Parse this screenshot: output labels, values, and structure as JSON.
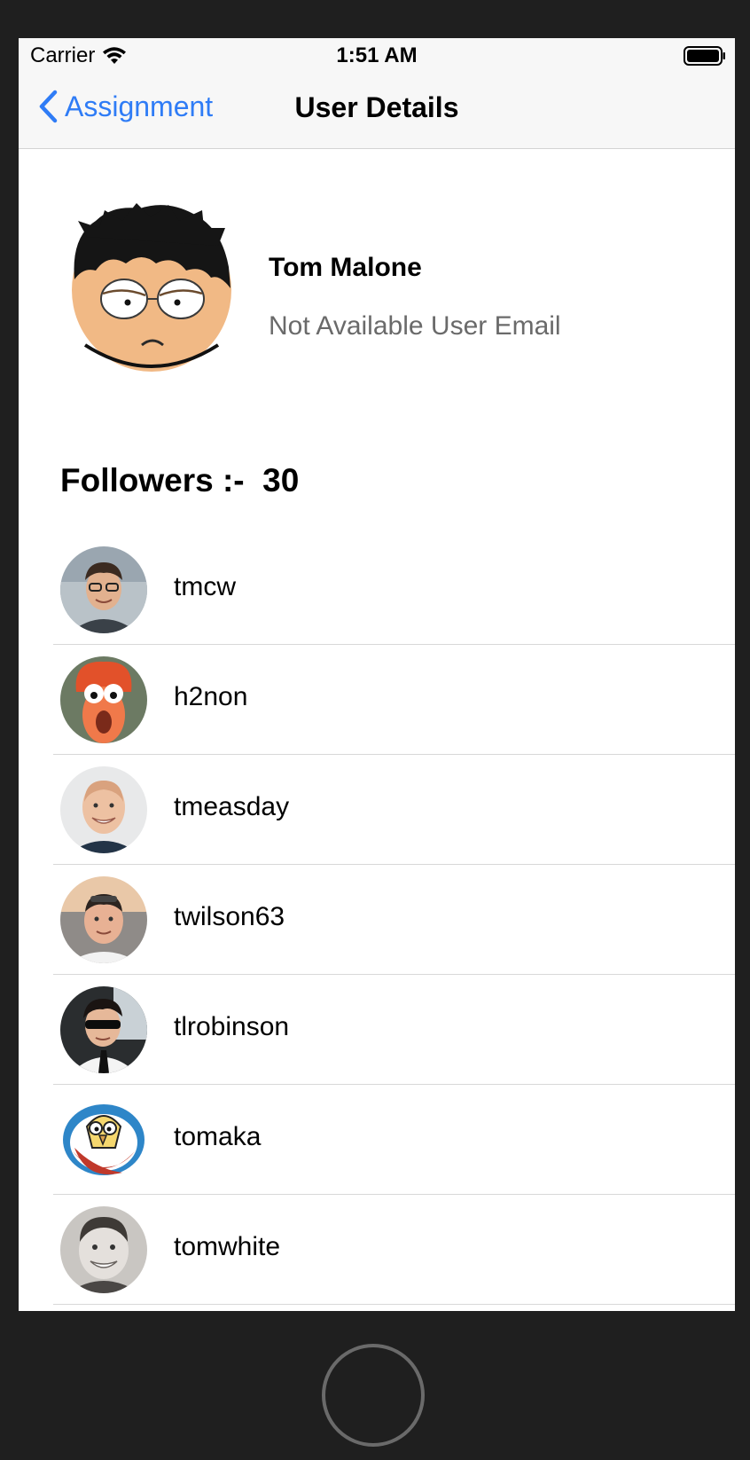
{
  "status_bar": {
    "carrier": "Carrier",
    "time": "1:51 AM"
  },
  "nav": {
    "back_label": "Assignment",
    "title": "User Details"
  },
  "profile": {
    "name": "Tom Malone",
    "email": "Not Available User Email"
  },
  "followers": {
    "heading": "Followers :-  30",
    "items": [
      {
        "login": "tmcw"
      },
      {
        "login": "h2non"
      },
      {
        "login": "tmeasday"
      },
      {
        "login": "twilson63"
      },
      {
        "login": "tlrobinson"
      },
      {
        "login": "tomaka"
      },
      {
        "login": "tomwhite"
      }
    ]
  },
  "colors": {
    "accent": "#2f7cf6",
    "secondary_text": "#6a6a6a",
    "bezel": "#1f1f1f"
  }
}
